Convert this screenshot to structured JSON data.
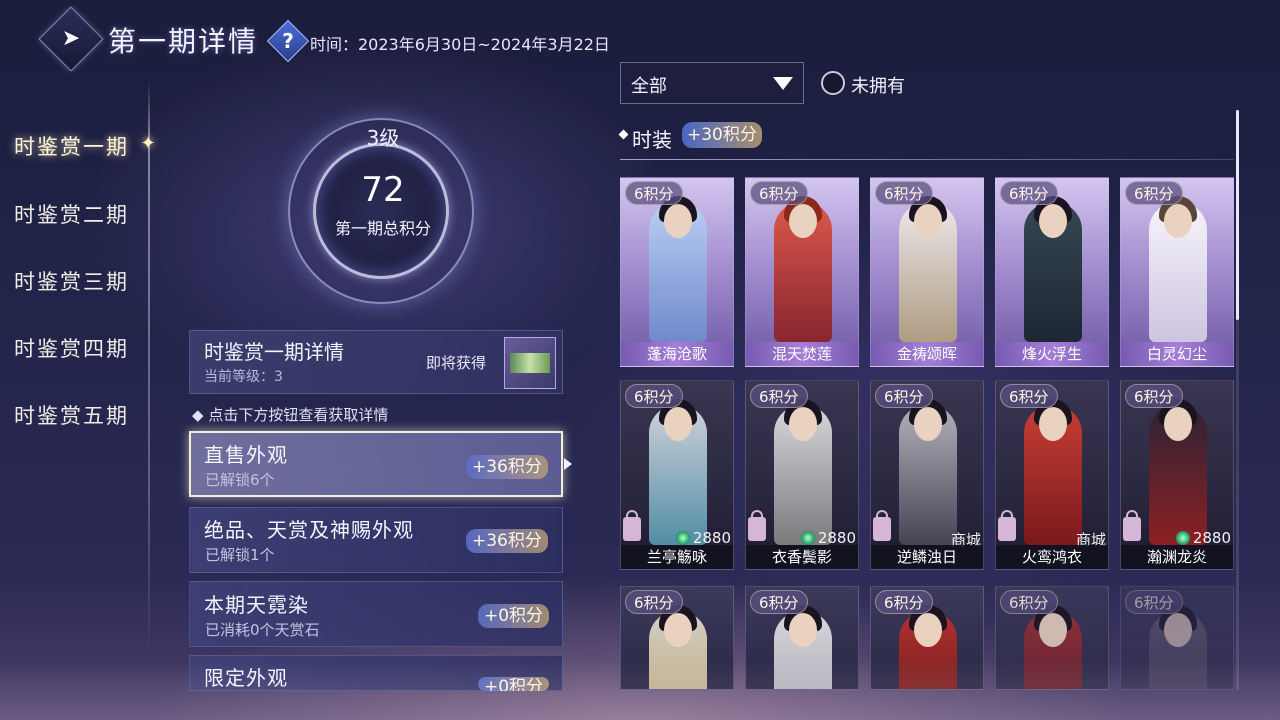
{
  "header": {
    "title": "第一期详情",
    "help": "?",
    "time": "时间：2023年6月30日~2024年3月22日"
  },
  "nav": {
    "items": [
      "时鉴赏一期",
      "时鉴赏二期",
      "时鉴赏三期",
      "时鉴赏四期",
      "时鉴赏五期"
    ],
    "active_index": 0
  },
  "level": {
    "level_label": "3级",
    "score": "72",
    "score_label": "第一期总积分"
  },
  "detail": {
    "title": "时鉴赏一期详情",
    "current_level": "当前等级：3",
    "soon": "即将获得"
  },
  "hint": "点击下方按钮查看获取详情",
  "categories": [
    {
      "title": "直售外观",
      "sub": "已解锁6个",
      "points": "+36积分"
    },
    {
      "title": "绝品、天赏及神赐外观",
      "sub": "已解锁1个",
      "points": "+36积分"
    },
    {
      "title": "本期天霓染",
      "sub": "已消耗0个天赏石",
      "points": "+0积分"
    },
    {
      "title": "限定外观",
      "sub": "",
      "points": "+0积分"
    }
  ],
  "filter": {
    "selected": "全部",
    "unowned_label": "未拥有"
  },
  "section": {
    "title": "时装",
    "points": "+30积分"
  },
  "cards_row1": [
    {
      "pts": "6积分",
      "name": "蓬海沧歌"
    },
    {
      "pts": "6积分",
      "name": "混天焚莲"
    },
    {
      "pts": "6积分",
      "name": "金祷颂晖"
    },
    {
      "pts": "6积分",
      "name": "烽火浮生"
    },
    {
      "pts": "6积分",
      "name": "白灵幻尘"
    }
  ],
  "cards_row2": [
    {
      "pts": "6积分",
      "name": "兰亭觞咏",
      "price": "2880"
    },
    {
      "pts": "6积分",
      "name": "衣香鬓影",
      "price": "2880"
    },
    {
      "pts": "6积分",
      "name": "逆鳞浊日",
      "price": "商城"
    },
    {
      "pts": "6积分",
      "name": "火鸾鸿衣",
      "price": "商城"
    },
    {
      "pts": "6积分",
      "name": "瀚渊龙炎",
      "price": "2880"
    }
  ],
  "cards_row3": [
    {
      "pts": "6积分"
    },
    {
      "pts": "6积分"
    },
    {
      "pts": "6积分"
    },
    {
      "pts": "6积分"
    },
    {
      "pts": "6积分"
    }
  ],
  "colors": {
    "accent_gold": "#fff3c4",
    "active_border": "#f3eedb",
    "coin_green": "#2aa46a"
  }
}
